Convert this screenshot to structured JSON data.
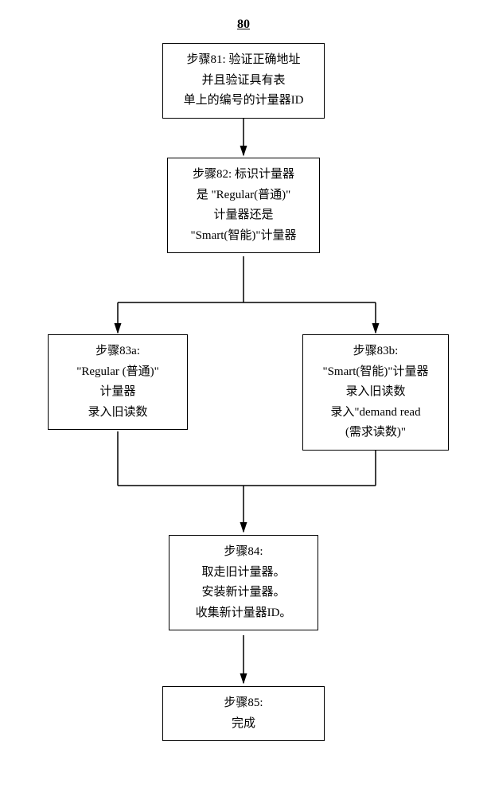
{
  "title": "80",
  "step81": {
    "line1": "步骤81: 验证正确地址",
    "line2": "并且验证具有表",
    "line3": "单上的编号的计量器ID"
  },
  "step82": {
    "line1": "步骤82: 标识计量器",
    "line2": "是 \"Regular(普通)\"",
    "line3": "计量器还是",
    "line4": "\"Smart(智能)\"计量器"
  },
  "step83a": {
    "line1": "步骤83a:",
    "line2": "\"Regular (普通)\"",
    "line3": "计量器",
    "line4": "录入旧读数"
  },
  "step83b": {
    "line1": "步骤83b:",
    "line2": "\"Smart(智能)\"计量器",
    "line3": "录入旧读数",
    "line4": "录入\"demand read",
    "line5": "(需求读数)\""
  },
  "step84": {
    "line1": "步骤84:",
    "line2": "取走旧计量器。",
    "line3": "安装新计量器。",
    "line4": "收集新计量器ID。"
  },
  "step85": {
    "line1": "步骤85:",
    "line2": "完成"
  }
}
